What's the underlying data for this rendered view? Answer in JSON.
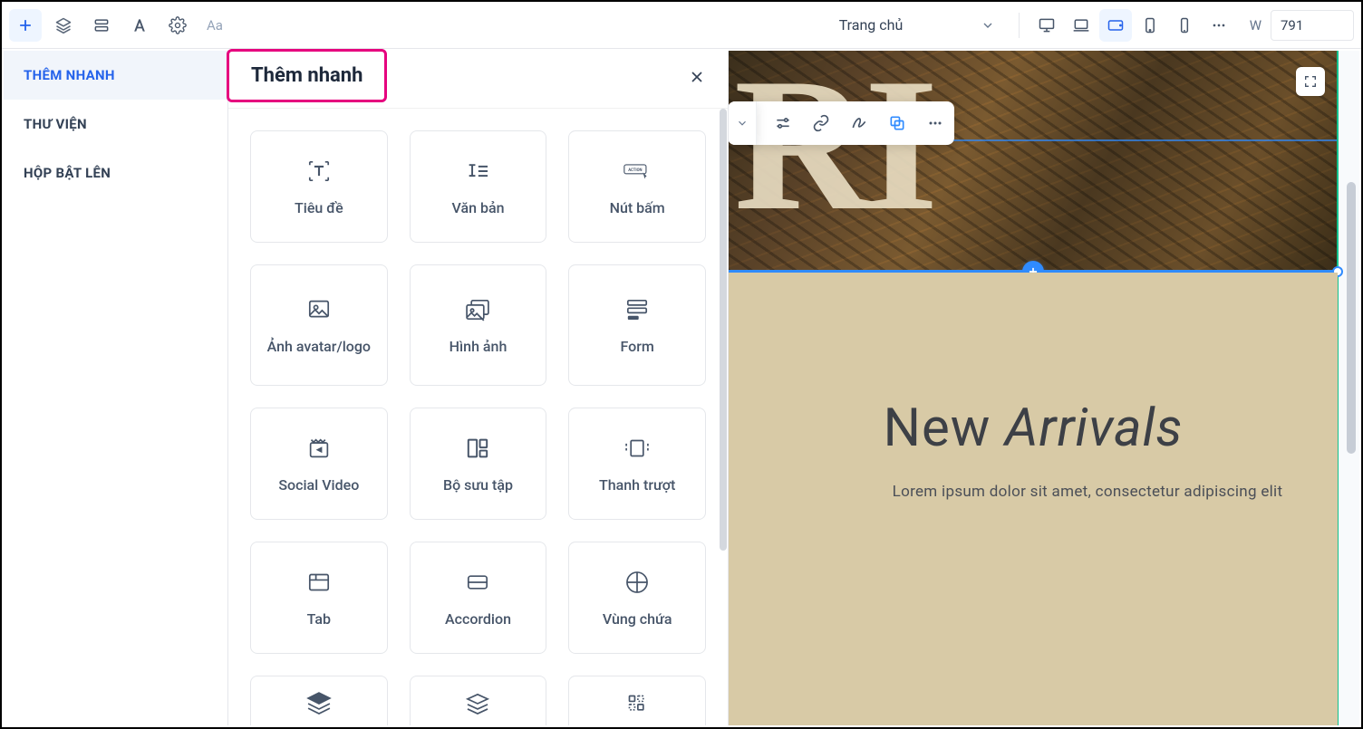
{
  "topbar": {
    "placeholder_text": "Aa",
    "page_select": "Trang chủ",
    "width_label": "W",
    "width_value": "791"
  },
  "left_tabs": [
    {
      "label": "THÊM NHANH",
      "active": true
    },
    {
      "label": "THƯ VIỆN",
      "active": false
    },
    {
      "label": "HỘP BẬT LÊN",
      "active": false
    }
  ],
  "panel": {
    "title": "Thêm nhanh",
    "cards": [
      {
        "label": "Tiêu đề",
        "icon": "heading"
      },
      {
        "label": "Văn bản",
        "icon": "text"
      },
      {
        "label": "Nút bấm",
        "icon": "button-action"
      },
      {
        "label": "Ảnh avatar/logo",
        "icon": "image"
      },
      {
        "label": "Hình ảnh",
        "icon": "images"
      },
      {
        "label": "Form",
        "icon": "form"
      },
      {
        "label": "Social Video",
        "icon": "video"
      },
      {
        "label": "Bộ sưu tập",
        "icon": "collection"
      },
      {
        "label": "Thanh trượt",
        "icon": "slider"
      },
      {
        "label": "Tab",
        "icon": "tab"
      },
      {
        "label": "Accordion",
        "icon": "accordion"
      },
      {
        "label": "Vùng chứa",
        "icon": "container"
      },
      {
        "label": "",
        "icon": "layers-solid"
      },
      {
        "label": "",
        "icon": "layers-outline"
      },
      {
        "label": "",
        "icon": "grid-scan"
      }
    ]
  },
  "canvas": {
    "hero_fragment": "RI",
    "section2_title_part1": "New ",
    "section2_title_part2": "Arrivals",
    "section2_sub": "Lorem ipsum dolor sit amet, consectetur adipiscing elit"
  }
}
